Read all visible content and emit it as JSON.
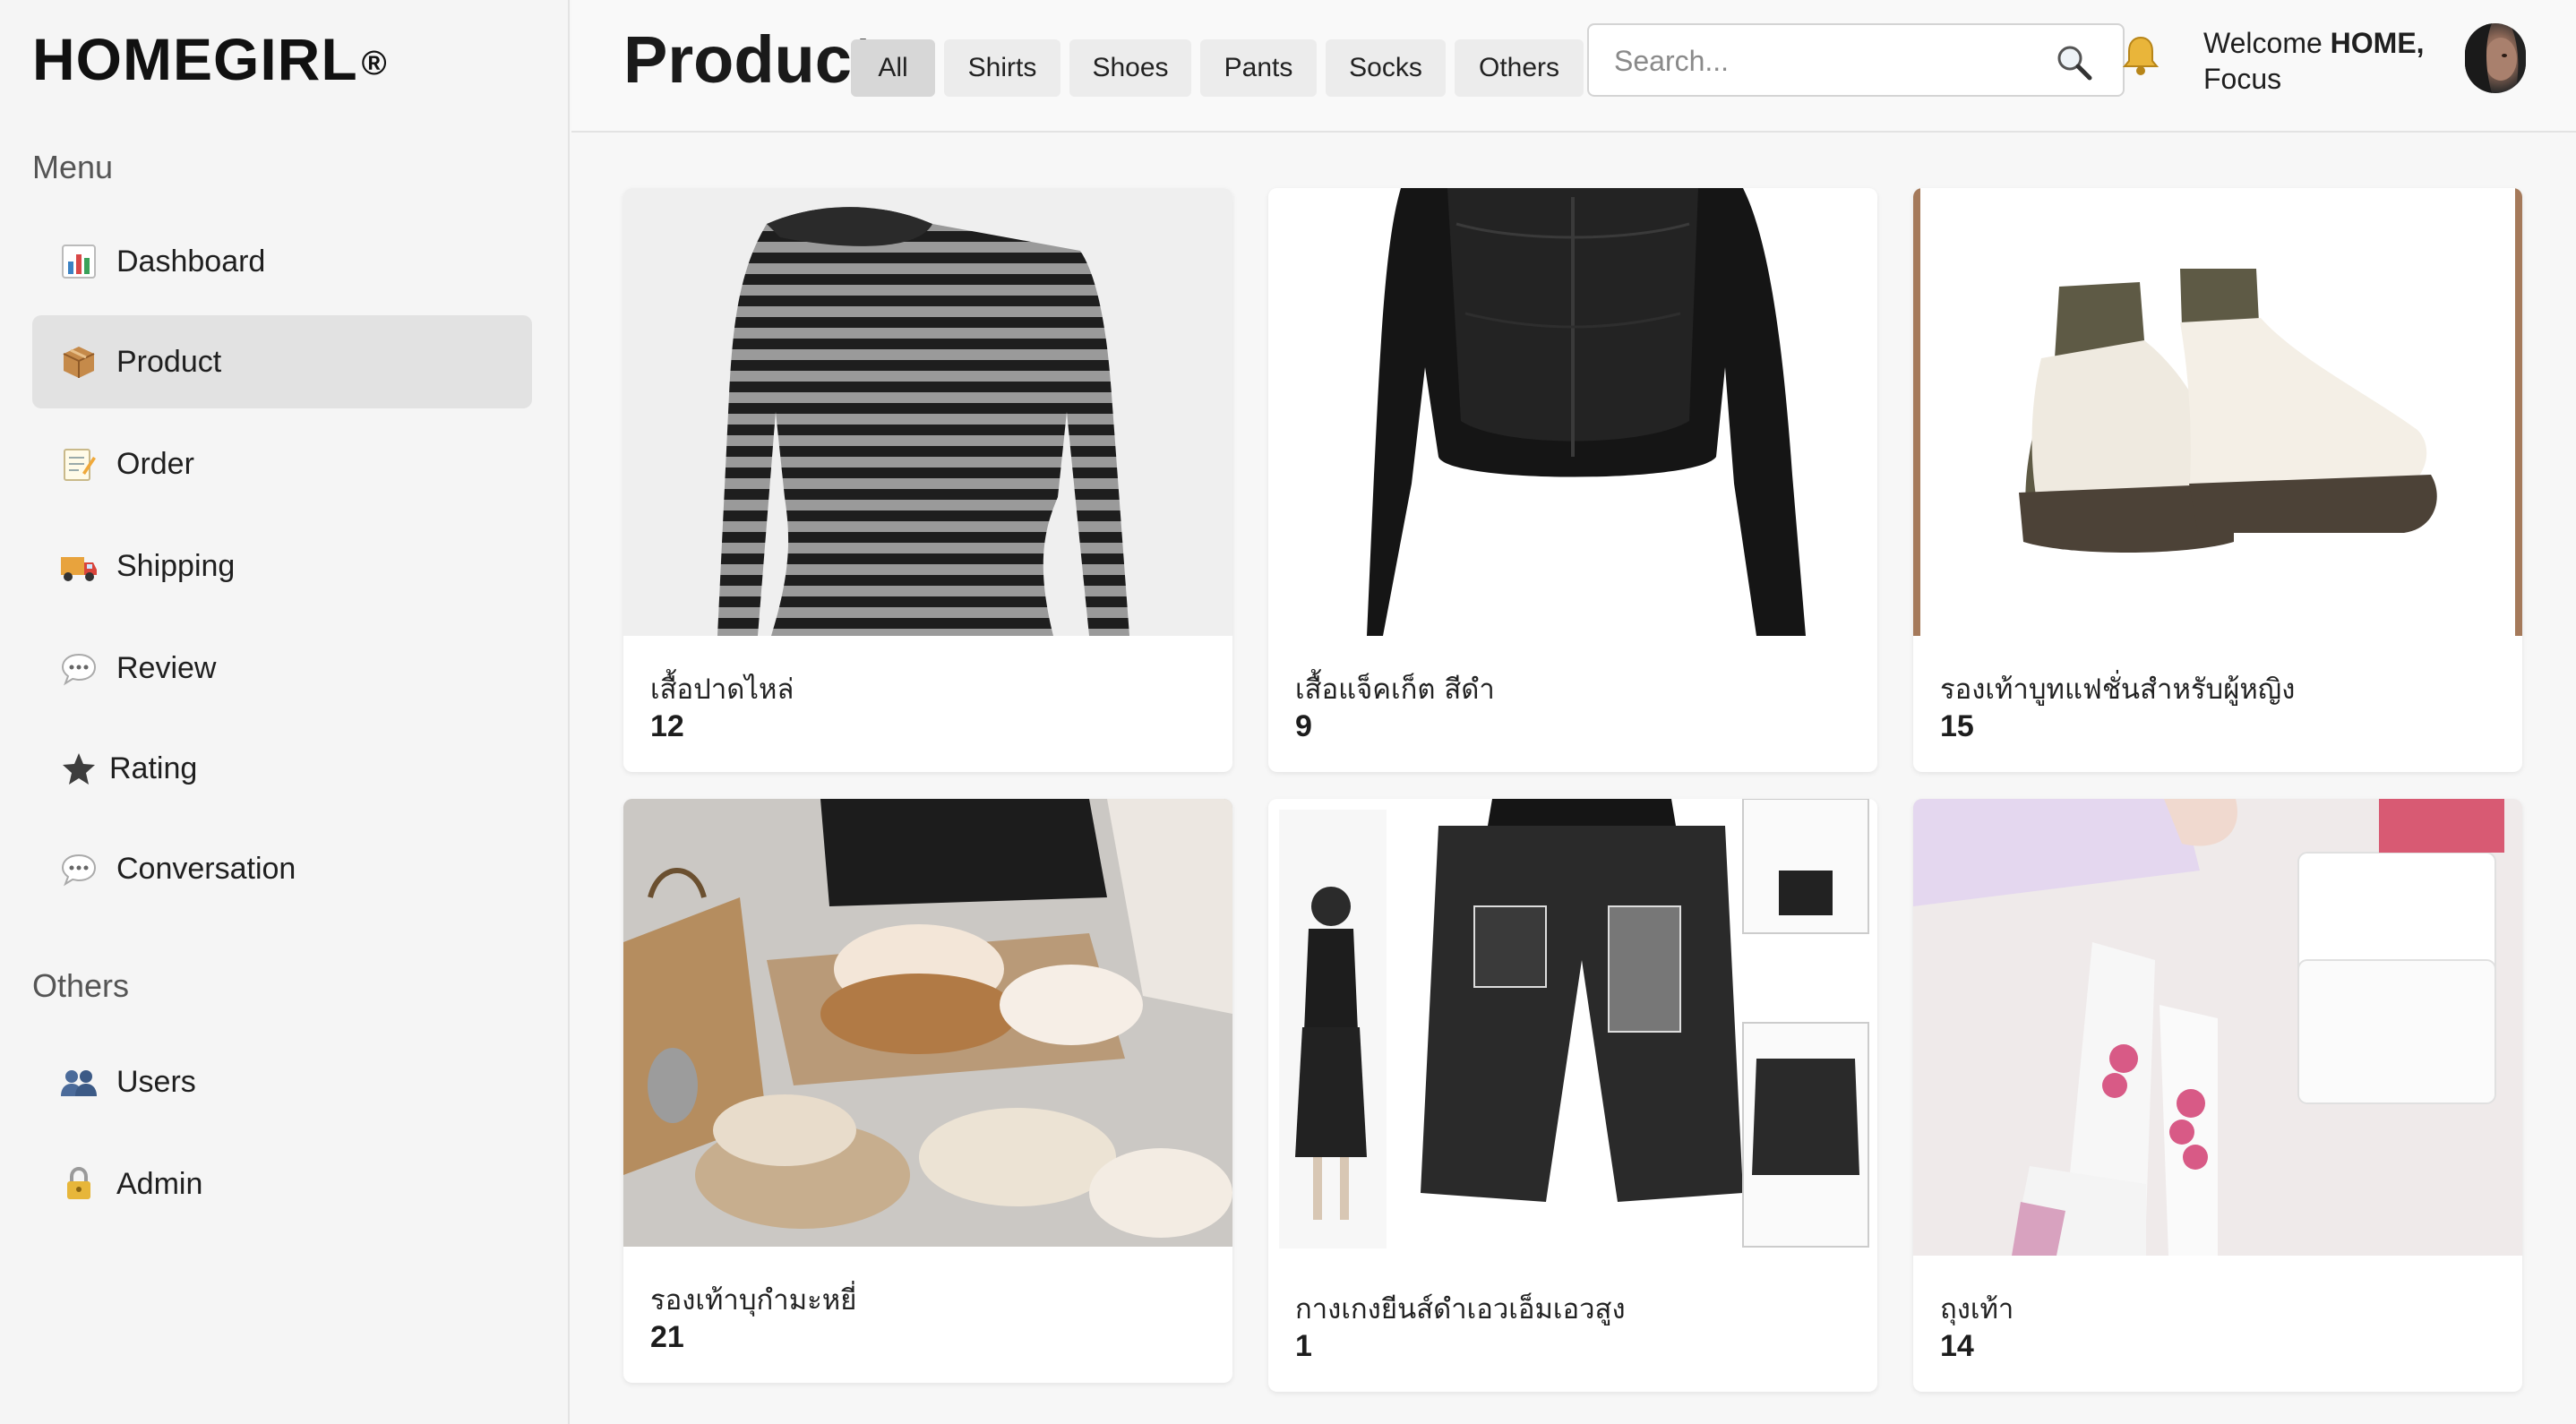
{
  "brand": {
    "name": "HOMEGIRL",
    "mark": "®"
  },
  "sidebar": {
    "menu_title": "Menu",
    "items": [
      {
        "label": "Dashboard",
        "icon": "chart-icon"
      },
      {
        "label": "Product",
        "icon": "package-icon",
        "active": true
      },
      {
        "label": "Order",
        "icon": "memo-icon"
      },
      {
        "label": "Shipping",
        "icon": "truck-icon"
      },
      {
        "label": "Review",
        "icon": "speech-bubble-icon"
      },
      {
        "label": "Rating",
        "icon": "star-icon"
      },
      {
        "label": "Conversation",
        "icon": "speech-bubble-icon"
      }
    ],
    "others_title": "Others",
    "others_items": [
      {
        "label": "Users",
        "icon": "users-icon"
      },
      {
        "label": "Admin",
        "icon": "lock-icon"
      }
    ]
  },
  "header": {
    "title": "Product",
    "tabs": [
      "All",
      "Shirts",
      "Shoes",
      "Pants",
      "Socks",
      "Others"
    ],
    "active_tab": "All",
    "search_placeholder": "Search...",
    "welcome_prefix": "Welcome ",
    "welcome_user": "HOME,",
    "welcome_line2": "Focus"
  },
  "products": [
    {
      "name": "เสื้อปาดไหล่",
      "qty": "12",
      "image": "striped-off-shoulder-top"
    },
    {
      "name": "เสื้อแจ็คเก็ต สีดำ",
      "qty": "9",
      "image": "black-leather-jacket"
    },
    {
      "name": "รองเท้าบูทแฟชั่นสำหรับผู้หญิง",
      "qty": "15",
      "image": "cream-ankle-boots"
    },
    {
      "name": "รองเท้าบุกำมะหยี่",
      "qty": "21",
      "image": "fur-lined-slippers"
    },
    {
      "name": "กางเกงยีนส์ดำเอวเอ็มเอวสูง",
      "qty": "1",
      "image": "black-denim-shorts"
    },
    {
      "name": "ถุงเท้า",
      "qty": "14",
      "image": "white-printed-socks"
    }
  ],
  "colors": {
    "active_bg": "#e2e2e2",
    "tab_bg": "#ececec",
    "tab_active_bg": "#d7d7d7",
    "page_bg": "#f7f7f7"
  }
}
